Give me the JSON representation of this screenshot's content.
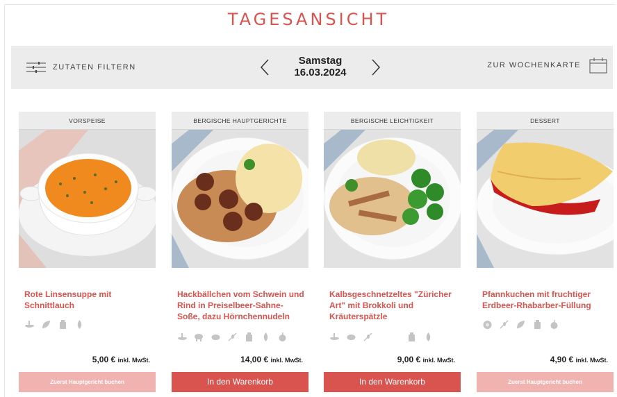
{
  "page": {
    "title": "TAGESANSICHT"
  },
  "toolbar": {
    "filter_label": "ZUTATEN FILTERN",
    "weekday": "Samstag",
    "date": "16.03.2024",
    "week_label": "ZUR WOCHENKARTE"
  },
  "colors": {
    "accent": "#d9534f",
    "accent_light": "#f0b3b0",
    "toolbar_bg": "#ececec",
    "icon_gray": "#c4c4c4"
  },
  "cards": [
    {
      "category": "VORSPEISE",
      "name": "Rote Linsensuppe mit Schnittlauch",
      "allergens": [
        "celery-icon",
        "leaf-icon",
        "bottle-icon",
        "drop-icon"
      ],
      "price": "5,00 €",
      "price_note": "inkl. MwSt.",
      "button": "Zuerst Hauptgericht buchen"
    },
    {
      "category": "BERGISCHE HAUPTGERICHTE",
      "name": "Hackbällchen vom Schwein und Rind in Preiselbeer-Sahne-Soße, dazu Hörnchennudeln",
      "allergens": [
        "celery-icon",
        "pig-icon",
        "cow-icon",
        "wheat-icon",
        "bottle-icon",
        "drop-icon",
        "apple-icon"
      ],
      "price": "14,00 €",
      "price_note": "inkl. MwSt.",
      "button": "In den Warenkorb"
    },
    {
      "category": "BERGISCHE LEICHTIGKEIT",
      "name": "Kalbsgeschnetzeltes \"Züricher Art\" mit Brokkoli und Kräuterspätzle",
      "allergens": [
        "celery-icon",
        "cow-icon",
        "wheat-icon",
        "bottle-icon",
        "drop-icon"
      ],
      "price": "9,00 €",
      "price_note": "inkl. MwSt.",
      "button": "In den Warenkorb"
    },
    {
      "category": "DESSERT",
      "name": "Pfannkuchen mit fruchtiger Erdbeer-Rhabarber-Füllung",
      "allergens": [
        "egg-icon",
        "wheat-icon",
        "leaf-icon",
        "bottle-icon",
        "apple-icon"
      ],
      "price": "4,90 €",
      "price_note": "inkl. MwSt.",
      "button": "Zuerst Hauptgericht buchen"
    }
  ]
}
